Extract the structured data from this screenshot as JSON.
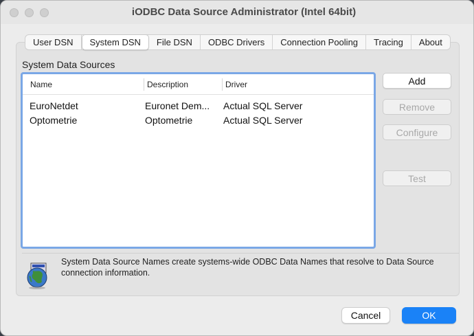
{
  "window": {
    "title": "iODBC Data Source Administrator (Intel 64bit)"
  },
  "tabs": [
    {
      "label": "User DSN",
      "active": false
    },
    {
      "label": "System DSN",
      "active": true
    },
    {
      "label": "File DSN",
      "active": false
    },
    {
      "label": "ODBC Drivers",
      "active": false
    },
    {
      "label": "Connection Pooling",
      "active": false
    },
    {
      "label": "Tracing",
      "active": false
    },
    {
      "label": "About",
      "active": false
    }
  ],
  "section": {
    "label": "System Data Sources"
  },
  "table": {
    "columns": [
      "Name",
      "Description",
      "Driver"
    ],
    "rows": [
      {
        "name": "EuroNetdet",
        "description": "Euronet Dem...",
        "driver": "Actual SQL Server"
      },
      {
        "name": "Optometrie",
        "description": "Optometrie",
        "driver": "Actual SQL Server"
      }
    ]
  },
  "side_buttons": {
    "add": "Add",
    "remove": "Remove",
    "configure": "Configure",
    "test": "Test"
  },
  "info": {
    "icon": "globe-computer-icon",
    "text": "System Data Source Names create systems-wide ODBC Data Names that resolve to Data Source connection information."
  },
  "footer": {
    "cancel": "Cancel",
    "ok": "OK"
  },
  "colors": {
    "accent": "#1a82f7",
    "focus_ring": "#7aa7e6"
  }
}
